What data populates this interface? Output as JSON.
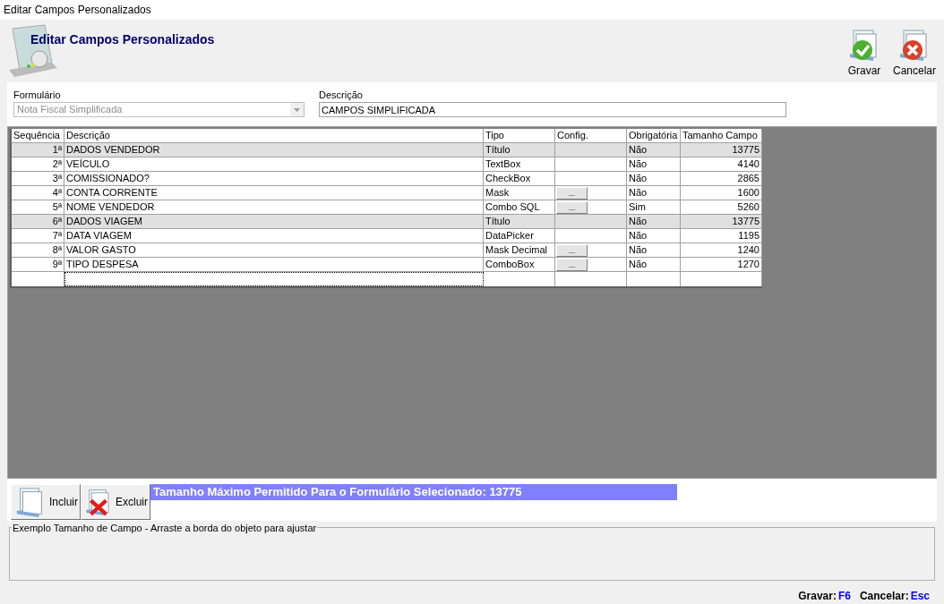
{
  "window": {
    "title": "Editar Campos Personalizados"
  },
  "header": {
    "title": "Editar Campos Personalizados"
  },
  "toolbar": [
    {
      "kind": "save",
      "label": "Gravar"
    },
    {
      "kind": "cancel",
      "label": "Cancelar"
    }
  ],
  "form": {
    "formulario": {
      "label": "Formulário",
      "value": "Nota Fiscal Simplificada",
      "disabled": true
    },
    "descricao": {
      "label": "Descrição",
      "value": "CAMPOS SIMPLIFICADA"
    }
  },
  "table": {
    "columns": [
      "Sequência",
      "Descrição",
      "Tipo",
      "Config.",
      "Obrigatória",
      "Tamanho Campo"
    ],
    "rows": [
      {
        "kind": "title",
        "seq": "1ª",
        "descricao": "DADOS VENDEDOR",
        "tipo": "Título",
        "config": false,
        "obrigatoria": "Não",
        "tamanho": "13775"
      },
      {
        "kind": "field",
        "seq": "2ª",
        "descricao": "VEÍCULO",
        "tipo": "TextBox",
        "config": false,
        "obrigatoria": "Não",
        "tamanho": "4140"
      },
      {
        "kind": "field",
        "seq": "3ª",
        "descricao": "COMISSIONADO?",
        "tipo": "CheckBox",
        "config": false,
        "obrigatoria": "Não",
        "tamanho": "2865"
      },
      {
        "kind": "field",
        "seq": "4ª",
        "descricao": "CONTA CORRENTE",
        "tipo": "Mask",
        "config": true,
        "obrigatoria": "Não",
        "tamanho": "1600"
      },
      {
        "kind": "field",
        "seq": "5ª",
        "descricao": "NOME VENDEDOR",
        "tipo": "Combo SQL",
        "config": true,
        "obrigatoria": "Sim",
        "tamanho": "5260"
      },
      {
        "kind": "title",
        "seq": "6ª",
        "descricao": "DADOS VIAGEM",
        "tipo": "Título",
        "config": false,
        "obrigatoria": "Não",
        "tamanho": "13775"
      },
      {
        "kind": "field",
        "seq": "7ª",
        "descricao": "DATA VIAGEM",
        "tipo": "DataPicker",
        "config": false,
        "obrigatoria": "Não",
        "tamanho": "1195"
      },
      {
        "kind": "field",
        "seq": "8ª",
        "descricao": "VALOR GASTO",
        "tipo": "Mask Decimal",
        "config": true,
        "obrigatoria": "Não",
        "tamanho": "1240"
      },
      {
        "kind": "field",
        "seq": "9ª",
        "descricao": "TIPO DESPESA",
        "tipo": "ComboBox",
        "config": true,
        "obrigatoria": "Não",
        "tamanho": "1270"
      }
    ],
    "config_button": "..."
  },
  "actions": [
    {
      "kind": "add",
      "label": "Incluir"
    },
    {
      "kind": "delete",
      "label": "Excluir"
    }
  ],
  "banner": "Tamanho Máximo Permitido Para o Formulário Selecionado: 13775",
  "example_group": {
    "title": "Exemplo Tamanho de Campo - Arraste a borda do objeto para ajustar"
  },
  "shortcuts": [
    {
      "label": "Gravar:",
      "key": "F6"
    },
    {
      "label": "Cancelar:",
      "key": "Esc"
    }
  ]
}
